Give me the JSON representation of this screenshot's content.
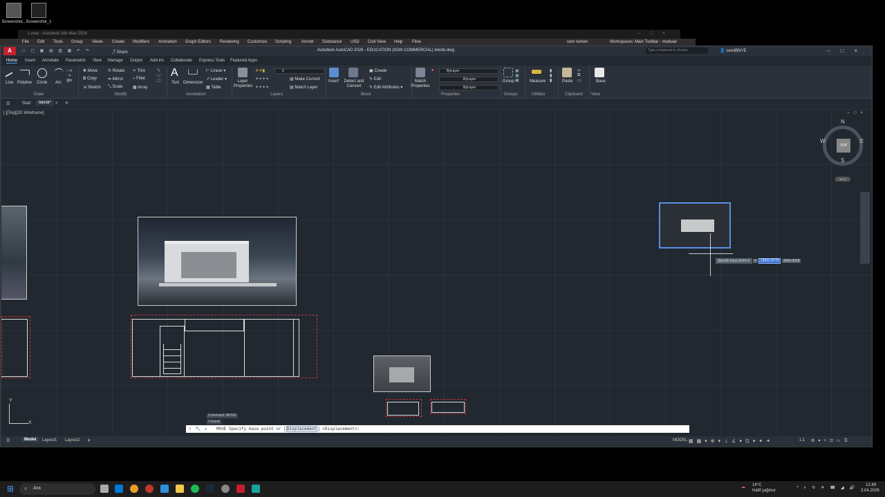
{
  "desktop": {
    "icons": [
      {
        "label": "Screenshot..."
      },
      {
        "label": "Screenshot_1"
      }
    ]
  },
  "max_window": {
    "title": "1.max - Autodesk 3ds Max 2026",
    "menu": [
      "File",
      "Edit",
      "Tools",
      "Group",
      "Views",
      "Create",
      "Modifiers",
      "Animation",
      "Graph Editors",
      "Rendering",
      "Customize",
      "Scripting",
      "Arnold",
      "Substance",
      "USD",
      "Civil View",
      "Help",
      "Flow"
    ],
    "user": "cem isimen",
    "workspaces_label": "Workspaces:",
    "workspace_value": "Main Toolbar - modular"
  },
  "acad": {
    "title": "Autodesk AutoCAD 2026 - EDUCATION (NON COMMERCIAL)   teknik.dwg",
    "share_label": "Share",
    "search_placeholder": "Type a keyword or phrase",
    "user": "cemIBNYE",
    "ribbon_tabs": [
      "Home",
      "Insert",
      "Annotate",
      "Parametric",
      "View",
      "Manage",
      "Output",
      "Add-ins",
      "Collaborate",
      "Express Tools",
      "Featured Apps"
    ],
    "draw": {
      "line": "Line",
      "polyline": "Polyline",
      "circle": "Circle",
      "arc": "Arc",
      "title": "Draw"
    },
    "modify": {
      "move": "Move",
      "rotate": "Rotate",
      "trim": "Trim",
      "copy": "Copy",
      "mirror": "Mirror",
      "fillet": "Fillet",
      "stretch": "Stretch",
      "scale": "Scale",
      "array": "Array",
      "title": "Modify"
    },
    "annotation": {
      "text": "Text",
      "dimension": "Dimension",
      "linear": "Linear",
      "leader": "Leader",
      "table": "Table",
      "title": "Annotation"
    },
    "layers": {
      "layer_properties": "Layer Properties",
      "layer_value": "0",
      "make_current": "Make Current",
      "match_layer": "Match Layer",
      "title": "Layers"
    },
    "block": {
      "insert": "Insert",
      "detect_convert": "Detect and Convert",
      "create": "Create",
      "edit": "Edit",
      "edit_attributes": "Edit Attributes",
      "title": "Block"
    },
    "properties": {
      "match_properties": "Match Properties",
      "bylayer1": "ByLayer",
      "bylayer2": "ByLayer",
      "bylayer3": "ByLayer",
      "title": "Properties"
    },
    "groups": {
      "group": "Group",
      "title": "Groups"
    },
    "utilities": {
      "measure": "Measure",
      "title": "Utilities"
    },
    "clipboard": {
      "paste": "Paste",
      "title": "Clipboard"
    },
    "view": {
      "base": "Base",
      "title": "View"
    },
    "file_tabs": {
      "start": "Start",
      "current": "teknik*"
    },
    "viewport_label": "[-][Top][2D Wireframe]",
    "viewcube": {
      "n": "N",
      "s": "S",
      "e": "E",
      "w": "W",
      "top": "TOP",
      "wcs": "WCS"
    },
    "tooltip": {
      "prompt": "Specify base point or",
      "x_value": "23922.8775",
      "y_value": "1904.4318"
    },
    "command_history": [
      "Command: MOVE",
      "1 found"
    ],
    "command_line": {
      "cmd": "MOVE",
      "prompt": "Specify base point or",
      "option": "Displacement",
      "default": "<Displacement>:"
    },
    "ucs": {
      "x": "X",
      "y": "Y"
    },
    "layout_tabs": [
      "Model",
      "Layout1",
      "Layout2"
    ],
    "status_model": "MODEL",
    "status_scale": "1:1"
  },
  "taskbar": {
    "search_label": "Ara",
    "weather_temp": "14°C",
    "weather_desc": "Hafif yağmur",
    "time": "12:49",
    "date": "3.04.2026"
  },
  "colors": {
    "accent": "#4aa3ff",
    "autocad_red": "#c61f2b",
    "viewport_bg": "#212830",
    "dashed_red": "#cc3333"
  }
}
